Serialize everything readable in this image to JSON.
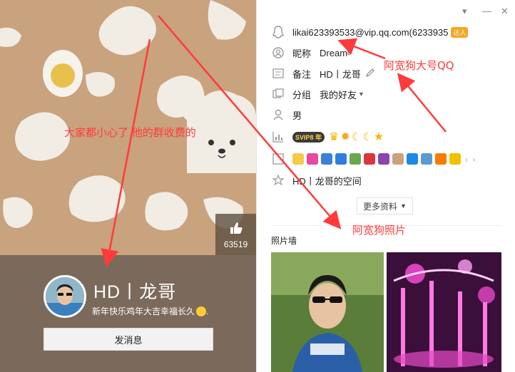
{
  "profile": {
    "name": "HD丨龙哥",
    "signature": "新年快乐鸡年大吉幸福长久",
    "send_message_label": "发消息",
    "like_count": "63519"
  },
  "info": {
    "email": "likai623393533@vip.qq.com(6233935",
    "vip_tag": "达人",
    "nickname_label": "昵称",
    "nickname": "Dream",
    "nickname_sup": "8",
    "remark_label": "备注",
    "remark": "HD丨龙哥",
    "group_label": "分组",
    "group": "我的好友",
    "gender": "男",
    "svip_text": "SVIP8",
    "svip_year": "年",
    "space": "HD丨龙哥的空间",
    "more_label": "更多资料",
    "photo_wall_label": "照片墙"
  },
  "annotations": {
    "warning": "大家都小心了 他的群收费的",
    "big_qq": "阿宽狗大号QQ",
    "photo": "阿宽狗照片"
  },
  "colors": {
    "cover_bg": "#c9a27e",
    "profile_bar": "#7b6a5b",
    "annotation": "#ff3b3b"
  },
  "icons": {
    "penguin": "qq-account-icon",
    "person": "nickname-icon",
    "card": "remark-icon",
    "group": "group-icon",
    "gender": "gender-icon",
    "level": "level-icon",
    "badges": "badges-icon",
    "star": "space-icon"
  }
}
